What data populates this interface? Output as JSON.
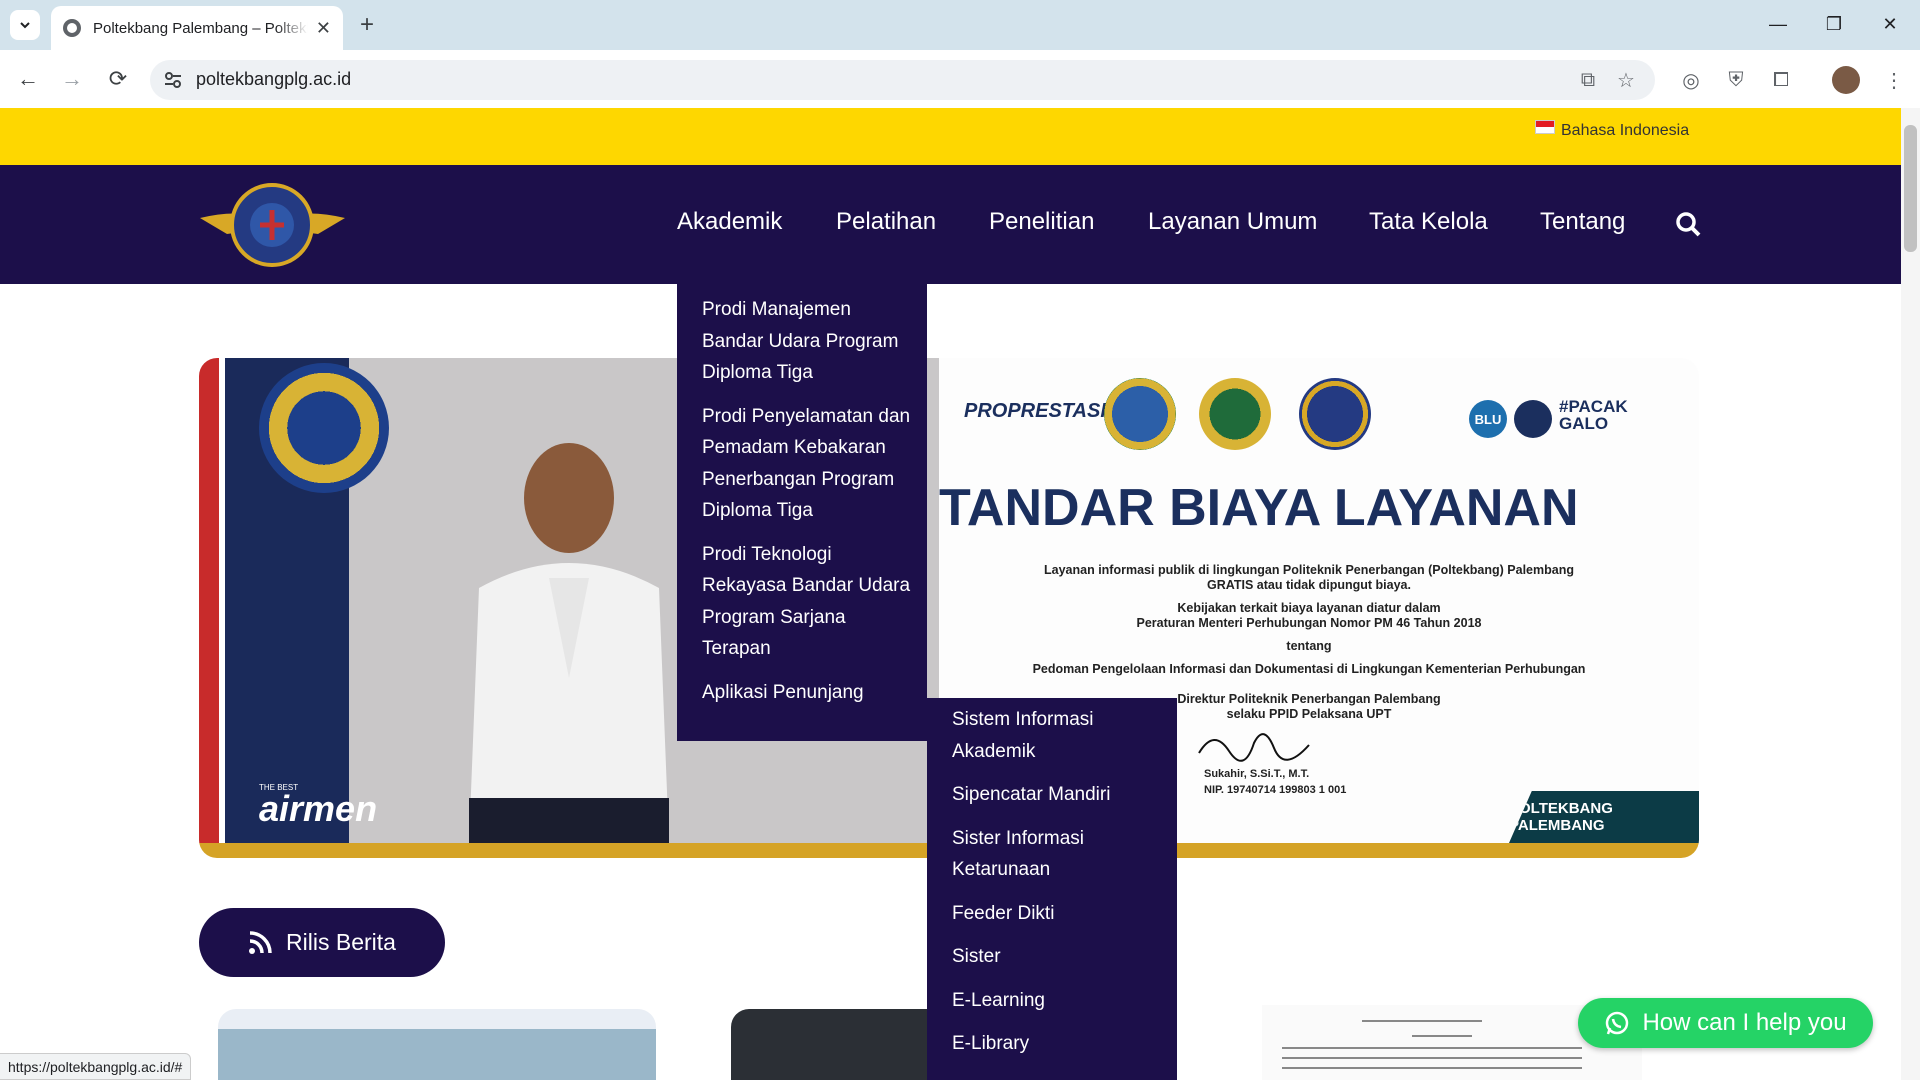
{
  "browser": {
    "tab_title": "Poltekbang Palembang – Poltekbang Palembang",
    "url": "poltekbangplg.ac.id",
    "status_url": "https://poltekbangplg.ac.id/#"
  },
  "topbar": {
    "language": "Bahasa Indonesia"
  },
  "nav": {
    "items": [
      "Akademik",
      "Pelatihan",
      "Penelitian",
      "Layanan Umum",
      "Tata Kelola",
      "Tentang"
    ]
  },
  "dropdown": {
    "items": [
      "Prodi Manajemen Bandar Udara Program Diploma Tiga",
      "Prodi Penyelamatan dan Pemadam Kebakaran Penerbangan Program Diploma Tiga",
      "Prodi Teknologi Rekayasa Bandar Udara Program Sarjana Terapan",
      "Aplikasi Penunjang"
    ],
    "submenu": [
      "Sistem Informasi Akademik",
      "Sipencatar Mandiri",
      "Sister Informasi Ketarunaan",
      "Feeder Dikti",
      "Sister",
      "E-Learning",
      "E-Library"
    ]
  },
  "banner": {
    "pp_logo": "PROPRESTASI",
    "blu": "BLU",
    "pacak": "#PACAK GALO",
    "headline": "TANDAR BIAYA LAYANAN",
    "line1": "Layanan informasi publik di lingkungan Politeknik Penerbangan (Poltekbang) Palembang",
    "line2": "GRATIS atau tidak dipungut biaya.",
    "line3": "Kebijakan terkait biaya layanan diatur dalam",
    "line4": "Peraturan Menteri Perhubungan Nomor PM 46 Tahun 2018",
    "line5": "tentang",
    "line6": "Pedoman Pengelolaan Informasi dan Dokumentasi di Lingkungan Kementerian Perhubungan",
    "line7": "Direktur Politeknik Penerbangan Palembang",
    "line8": "selaku PPID Pelaksana UPT",
    "sign_name": "Sukahir, S.Si.T., M.T.",
    "sign_nip": "NIP. 19740714 199803 1 001",
    "badge": "POLTEKBANG PALEMBANG",
    "airmen": "airmen",
    "airmen_tag": "THE BEST"
  },
  "rilis_label": "Rilis Berita",
  "help_label": "How can I help you",
  "colors": {
    "navy": "#1c0f4a",
    "yellow": "#fed700",
    "whatsapp": "#25d366",
    "gold": "#d5a326"
  }
}
